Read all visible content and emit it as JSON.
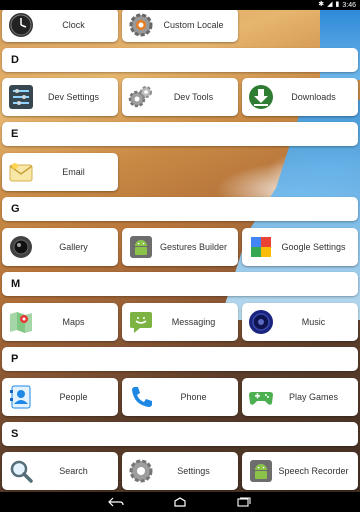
{
  "status_bar": {
    "time": "3:46"
  },
  "sections": [
    {
      "header": "",
      "apps": [
        "Clock",
        "Custom Locale"
      ]
    },
    {
      "header": "D",
      "apps": [
        "Dev Settings",
        "Dev Tools",
        "Downloads"
      ]
    },
    {
      "header": "E",
      "apps": [
        "Email"
      ]
    },
    {
      "header": "G",
      "apps": [
        "Gallery",
        "Gestures Builder",
        "Google Settings"
      ]
    },
    {
      "header": "M",
      "apps": [
        "Maps",
        "Messaging",
        "Music"
      ]
    },
    {
      "header": "P",
      "apps": [
        "People",
        "Phone",
        "Play Games"
      ]
    },
    {
      "header": "S",
      "apps": [
        "Search",
        "Settings",
        "Speech Recorder"
      ]
    }
  ],
  "icons": {
    "clock": "clock-icon",
    "custom_locale": "gear-icon",
    "dev_settings": "settings-list-icon",
    "dev_tools": "gears-icon",
    "downloads": "download-icon",
    "email": "envelope-icon",
    "gallery": "camera-lens-icon",
    "gestures_builder": "android-icon",
    "google_settings": "puzzle-icon",
    "maps": "map-icon",
    "messaging": "chat-bubble-icon",
    "music": "speaker-icon",
    "people": "contact-icon",
    "phone": "phone-handset-icon",
    "play_games": "gamepad-icon",
    "search": "magnifier-icon",
    "settings": "gear-icon",
    "speech_recorder": "android-icon"
  },
  "colors": {
    "accent_green": "#8bc34a",
    "card_bg": "#ffffff",
    "header_text": "#111111"
  }
}
